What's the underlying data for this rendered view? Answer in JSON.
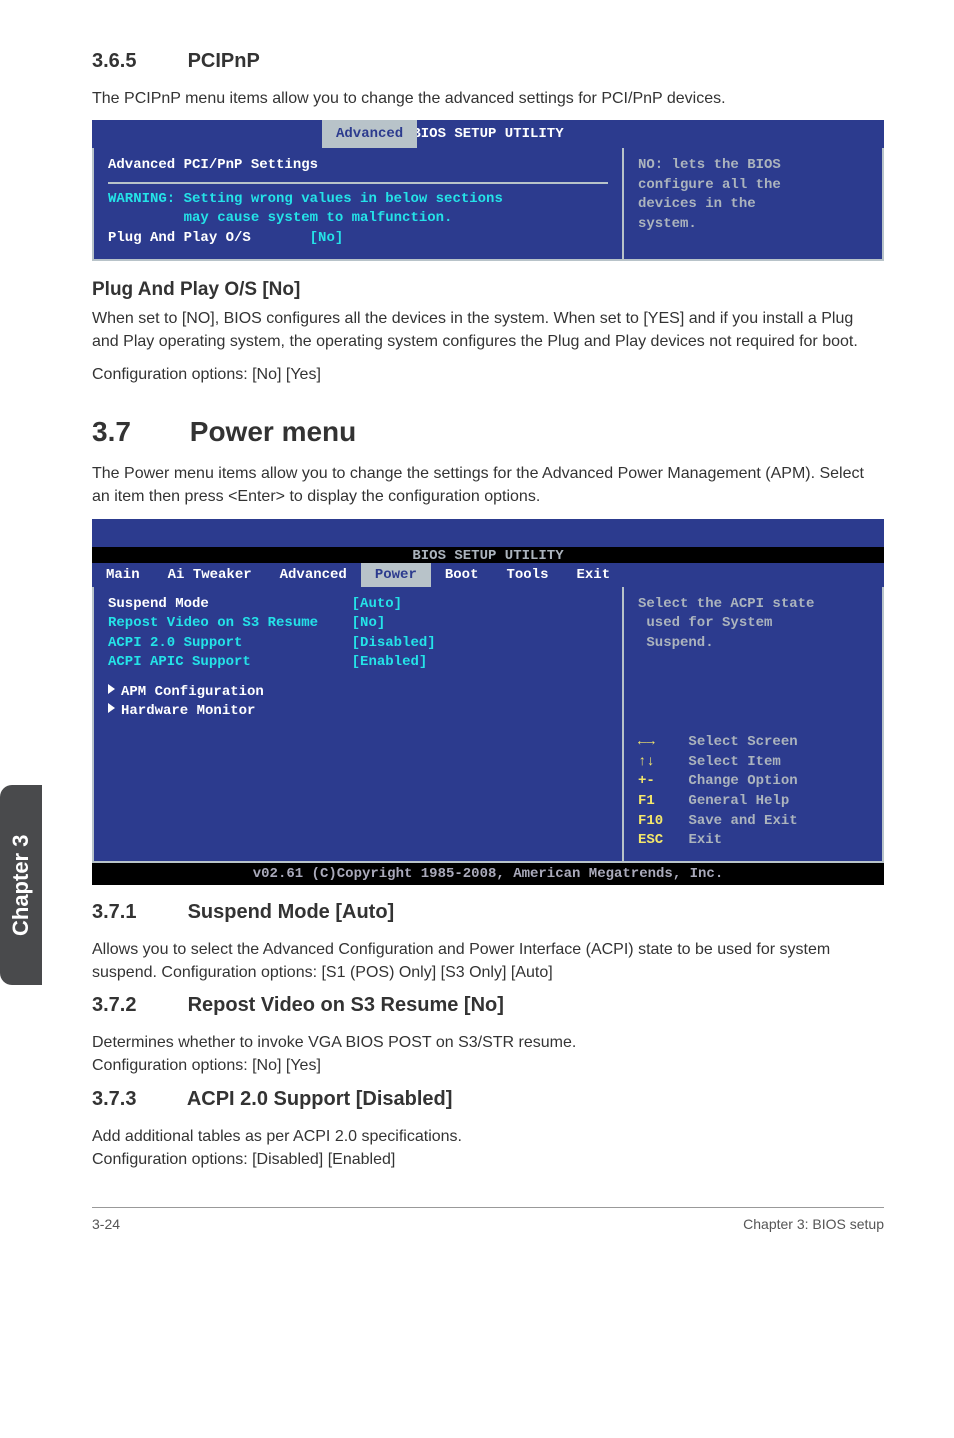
{
  "sidetab": "Chapter 3",
  "s365": {
    "num": "3.6.5",
    "title": "PCIPnP",
    "intro": "The PCIPnP menu items allow you to change the advanced settings for PCI/PnP devices."
  },
  "bios1": {
    "util_title": "BIOS SETUP UTILITY",
    "tab": "Advanced",
    "heading": "Advanced PCI/PnP Settings",
    "warn1": "WARNING: Setting wrong values in below sections",
    "warn2": "         may cause system to malfunction.",
    "item_label": "Plug And Play O/S",
    "item_val": "[No]",
    "help1": "NO: lets the BIOS",
    "help2": "configure all the",
    "help3": "devices in the",
    "help4": "system."
  },
  "pap": {
    "title": "Plug And Play O/S [No]",
    "p1": "When set to [NO], BIOS configures all the devices in the system. When set to [YES] and if you install a Plug and Play operating system, the operating system configures the Plug and Play devices not required for boot.",
    "p2": "Configuration options: [No] [Yes]"
  },
  "s37": {
    "num": "3.7",
    "title": "Power menu",
    "intro": "The Power menu items allow you to change the settings for the Advanced Power Management (APM). Select an item then press <Enter> to display the configuration options."
  },
  "bios2": {
    "util_title": "BIOS SETUP UTILITY",
    "tabs": [
      "Main",
      "Ai Tweaker",
      "Advanced",
      "Power",
      "Boot",
      "Tools",
      "Exit"
    ],
    "rows": [
      {
        "label": "Suspend Mode",
        "val": "[Auto]"
      },
      {
        "label": "Repost Video on S3 Resume",
        "val": "[No]"
      },
      {
        "label": "ACPI 2.0 Support",
        "val": "[Disabled]"
      },
      {
        "label": "ACPI APIC Support",
        "val": "[Enabled]"
      }
    ],
    "sub1": "APM Configuration",
    "sub2": "Hardware Monitor",
    "help1": "Select the ACPI state",
    "help2": " used for System",
    "help3": " Suspend.",
    "legend": [
      {
        "k": "←→",
        "v": "Select Screen"
      },
      {
        "k": "↑↓",
        "v": "Select Item"
      },
      {
        "k": "+-",
        "v": "Change Option"
      },
      {
        "k": "F1",
        "v": "General Help"
      },
      {
        "k": "F10",
        "v": "Save and Exit"
      },
      {
        "k": "ESC",
        "v": "Exit"
      }
    ],
    "copy": "v02.61 (C)Copyright 1985-2008, American Megatrends, Inc."
  },
  "s371": {
    "num": "3.7.1",
    "title": "Suspend Mode [Auto]",
    "p": "Allows you to select the Advanced Configuration and Power Interface (ACPI) state to be used for system suspend. Configuration options: [S1 (POS) Only] [S3 Only] [Auto]"
  },
  "s372": {
    "num": "3.7.2",
    "title": "Repost Video on S3 Resume [No]",
    "p1": "Determines whether to invoke VGA BIOS POST on S3/STR resume.",
    "p2": "Configuration options: [No] [Yes]"
  },
  "s373": {
    "num": "3.7.3",
    "title": "ACPI 2.0 Support [Disabled]",
    "p1": "Add additional tables as per ACPI 2.0 specifications.",
    "p2": "Configuration options: [Disabled] [Enabled]"
  },
  "footer": {
    "left": "3-24",
    "right": "Chapter 3: BIOS setup"
  }
}
